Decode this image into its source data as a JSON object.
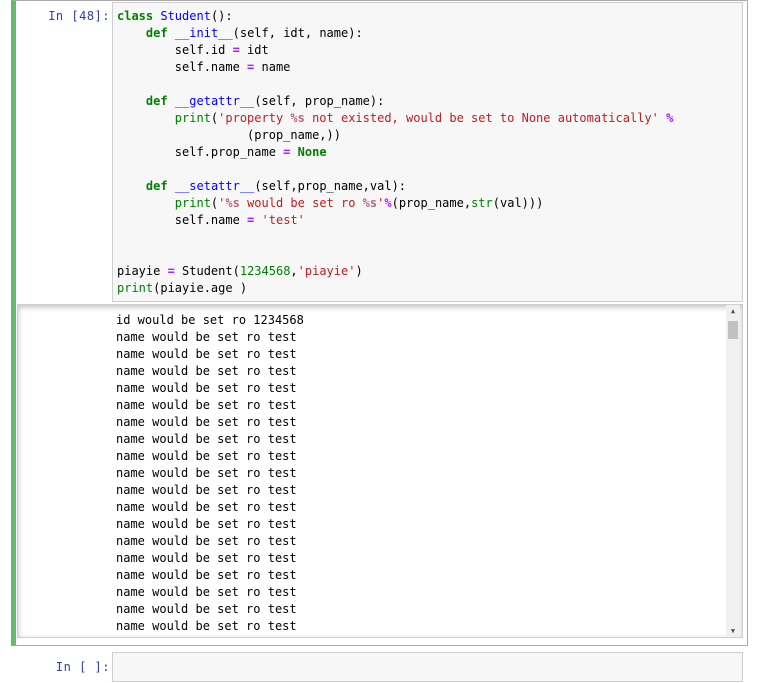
{
  "cells": [
    {
      "prompt": "In [48]:",
      "code_lines": [
        [
          {
            "t": "class",
            "c": "kw"
          },
          {
            "t": " "
          },
          {
            "t": "Student",
            "c": "cls"
          },
          {
            "t": "():"
          }
        ],
        [
          {
            "t": "    "
          },
          {
            "t": "def",
            "c": "kw"
          },
          {
            "t": " "
          },
          {
            "t": "__init__",
            "c": "fn"
          },
          {
            "t": "(self, idt, name):"
          }
        ],
        [
          {
            "t": "        self.id "
          },
          {
            "t": "=",
            "c": "op"
          },
          {
            "t": " idt"
          }
        ],
        [
          {
            "t": "        self.name "
          },
          {
            "t": "=",
            "c": "op"
          },
          {
            "t": " name"
          }
        ],
        [
          {
            "t": ""
          }
        ],
        [
          {
            "t": "    "
          },
          {
            "t": "def",
            "c": "kw"
          },
          {
            "t": " "
          },
          {
            "t": "__getattr__",
            "c": "fn"
          },
          {
            "t": "(self, prop_name):"
          }
        ],
        [
          {
            "t": "        "
          },
          {
            "t": "print",
            "c": "bi"
          },
          {
            "t": "("
          },
          {
            "t": "'property ",
            "c": "str"
          },
          {
            "t": "%s",
            "c": "fmt"
          },
          {
            "t": " not existed, would be set to None automatically'",
            "c": "str"
          },
          {
            "t": " "
          },
          {
            "t": "%",
            "c": "pct"
          }
        ],
        [
          {
            "t": "                  (prop_name,))"
          }
        ],
        [
          {
            "t": "        self.prop_name "
          },
          {
            "t": "=",
            "c": "op"
          },
          {
            "t": " "
          },
          {
            "t": "None",
            "c": "kw"
          }
        ],
        [
          {
            "t": ""
          }
        ],
        [
          {
            "t": "    "
          },
          {
            "t": "def",
            "c": "kw"
          },
          {
            "t": " "
          },
          {
            "t": "__setattr__",
            "c": "fn"
          },
          {
            "t": "(self,prop_name,val):"
          }
        ],
        [
          {
            "t": "        "
          },
          {
            "t": "print",
            "c": "bi"
          },
          {
            "t": "("
          },
          {
            "t": "'",
            "c": "str"
          },
          {
            "t": "%s",
            "c": "fmt"
          },
          {
            "t": " would be set ro ",
            "c": "str"
          },
          {
            "t": "%s",
            "c": "fmt"
          },
          {
            "t": "'",
            "c": "str"
          },
          {
            "t": "%",
            "c": "pct"
          },
          {
            "t": "(prop_name,"
          },
          {
            "t": "str",
            "c": "bi"
          },
          {
            "t": "(val)))"
          }
        ],
        [
          {
            "t": "        self.name "
          },
          {
            "t": "=",
            "c": "op"
          },
          {
            "t": " "
          },
          {
            "t": "'test'",
            "c": "str"
          }
        ],
        [
          {
            "t": ""
          }
        ],
        [
          {
            "t": ""
          }
        ],
        [
          {
            "t": "piayie "
          },
          {
            "t": "=",
            "c": "op"
          },
          {
            "t": " Student("
          },
          {
            "t": "1234568",
            "c": "num"
          },
          {
            "t": ","
          },
          {
            "t": "'piayie'",
            "c": "str"
          },
          {
            "t": ")"
          }
        ],
        [
          {
            "t": "print",
            "c": "bi"
          },
          {
            "t": "(piayie.age )"
          }
        ]
      ],
      "output_lines": [
        "id would be set ro 1234568",
        "name would be set ro test",
        "name would be set ro test",
        "name would be set ro test",
        "name would be set ro test",
        "name would be set ro test",
        "name would be set ro test",
        "name would be set ro test",
        "name would be set ro test",
        "name would be set ro test",
        "name would be set ro test",
        "name would be set ro test",
        "name would be set ro test",
        "name would be set ro test",
        "name would be set ro test",
        "name would be set ro test",
        "name would be set ro test",
        "name would be set ro test",
        "name would be set ro test",
        "name would be set ro test"
      ]
    },
    {
      "prompt": "In [ ]:"
    }
  ],
  "icons": {
    "scroll_up": "up-arrow",
    "scroll_down": "down-arrow"
  },
  "colors": {
    "selected_cell_border": "#66bb6a",
    "prompt": "#303f9f",
    "input_background": "#f7f7f7"
  }
}
